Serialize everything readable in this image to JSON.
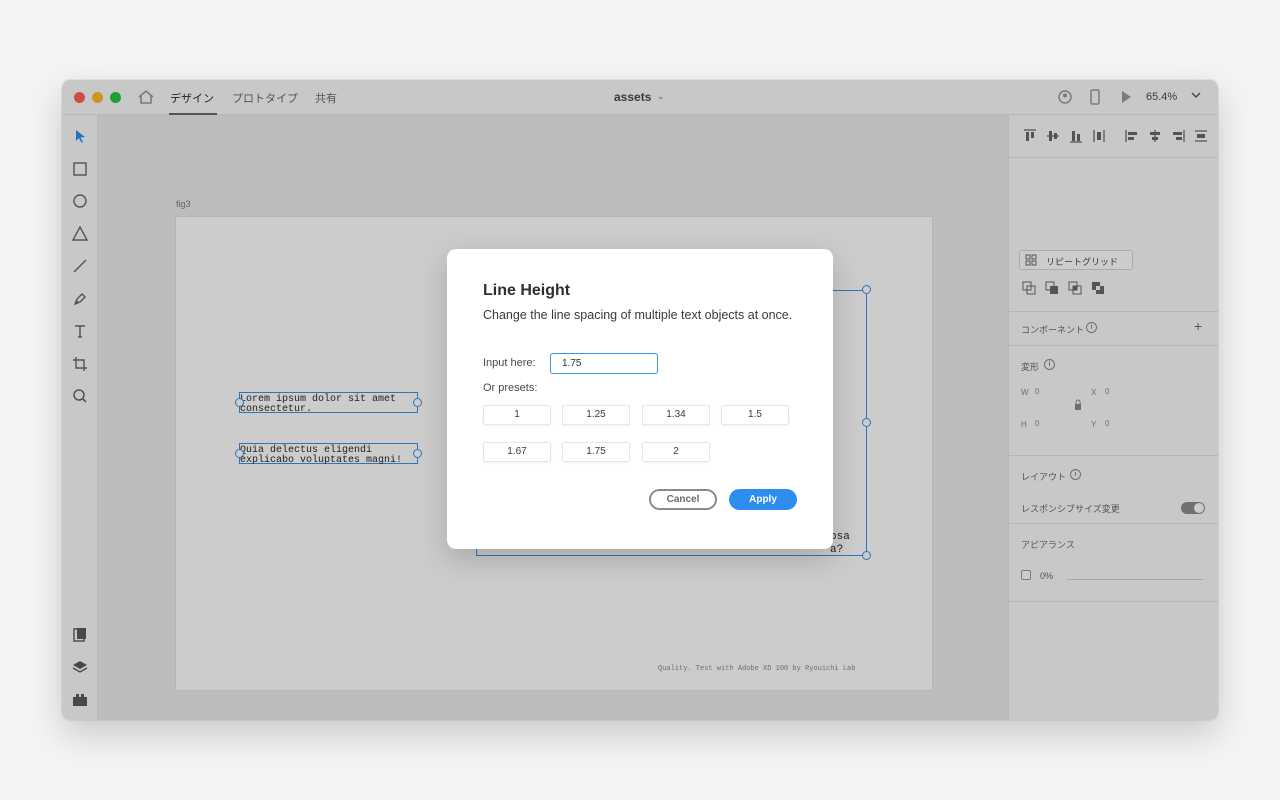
{
  "titlebar": {
    "tabs": [
      "デザイン",
      "プロトタイプ",
      "共有"
    ],
    "document_title": "assets",
    "zoom": "65.4%"
  },
  "canvas": {
    "artboard_name": "fig3",
    "text_objects": [
      "Lorem ipsum dolor sit amet\nconsectetur.",
      "Quia delectus eligendi\nexplicabo voluptates magni!"
    ],
    "partially_hidden_text": [
      "osa",
      "a?"
    ],
    "footer_text": "Quality. Test with Adobe XD 100 by Ryouichi Lab"
  },
  "right_panel": {
    "repeat_grid_label": "リピートグリッド",
    "component_label": "コンポーネント",
    "transform_label": "変形",
    "w_label": "W",
    "h_label": "H",
    "x_label": "X",
    "y_label": "Y",
    "w_value": "0",
    "h_value": "0",
    "x_value": "0",
    "y_value": "0",
    "layout_label": "レイアウト",
    "responsive_resize_label": "レスポンシブサイズ変更",
    "appearance_label": "アピアランス",
    "opacity_value": "0%"
  },
  "dialog": {
    "title": "Line Height",
    "description": "Change the line spacing of multiple text objects at once.",
    "input_label": "Input here:",
    "input_value": "1.75",
    "presets_label": "Or presets:",
    "presets": [
      "1",
      "1.25",
      "1.34",
      "1.5",
      "1.67",
      "1.75",
      "2"
    ],
    "cancel_label": "Cancel",
    "apply_label": "Apply"
  },
  "colors": {
    "accent": "#2d8ef0",
    "selection": "#3b93e6",
    "traffic_red": "#ff5f57",
    "traffic_yellow": "#febc2e",
    "traffic_green": "#28c840"
  }
}
